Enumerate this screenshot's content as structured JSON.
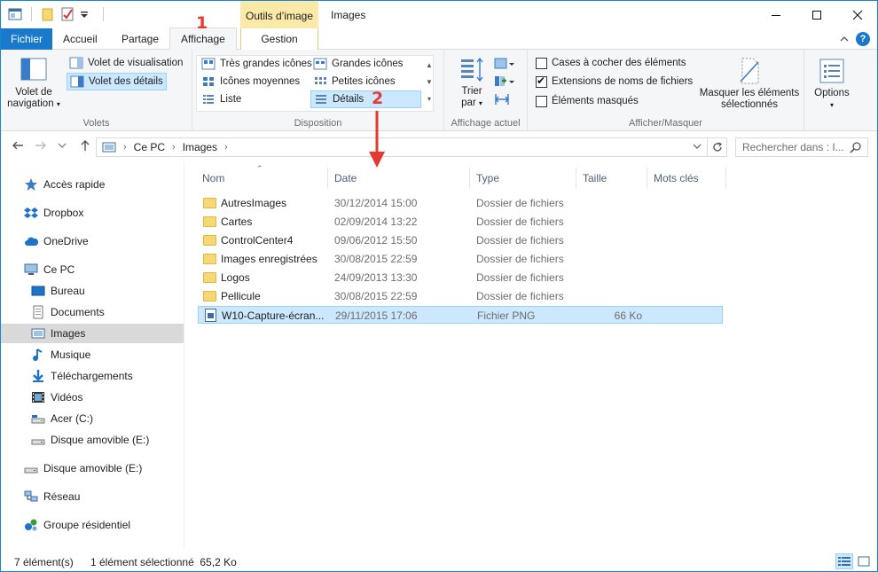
{
  "window": {
    "title": "Images",
    "contextual_tab": "Outils d’image",
    "controls": [
      "minimize-icon",
      "maximize-icon",
      "close-icon"
    ]
  },
  "tabs": {
    "file": "Fichier",
    "home": "Accueil",
    "share": "Partage",
    "view": "Affichage",
    "manage": "Gestion"
  },
  "ribbon": {
    "panes": {
      "label": "Volets",
      "nav_pane": "Volet de navigation",
      "preview_pane": "Volet de visualisation",
      "details_pane": "Volet des détails"
    },
    "layout": {
      "label": "Disposition",
      "options": [
        "Très grandes icônes",
        "Grandes icônes",
        "Icônes moyennes",
        "Petites icônes",
        "Liste",
        "Détails"
      ],
      "selected": "Détails"
    },
    "current_view": {
      "label": "Affichage actuel",
      "sort_by": "Trier par"
    },
    "show_hide": {
      "label": "Afficher/Masquer",
      "item_checkboxes": "Cases à cocher des éléments",
      "file_extensions": "Extensions de noms de fichiers",
      "hidden_items": "Éléments masqués",
      "hide_selected": "Masquer les éléments sélectionnés"
    },
    "options": "Options"
  },
  "address": {
    "crumbs": [
      "Ce PC",
      "Images"
    ],
    "search_placeholder": "Rechercher dans : I..."
  },
  "sidebar": {
    "items": [
      {
        "label": "Accès rapide",
        "icon": "star-icon"
      },
      {
        "label": "Dropbox",
        "icon": "dropbox-icon"
      },
      {
        "label": "OneDrive",
        "icon": "cloud-icon"
      },
      {
        "label": "Ce PC",
        "icon": "computer-icon"
      },
      {
        "label": "Bureau",
        "icon": "desktop-icon"
      },
      {
        "label": "Documents",
        "icon": "document-icon"
      },
      {
        "label": "Images",
        "icon": "pictures-icon"
      },
      {
        "label": "Musique",
        "icon": "music-icon"
      },
      {
        "label": "Téléchargements",
        "icon": "download-icon"
      },
      {
        "label": "Vidéos",
        "icon": "video-icon"
      },
      {
        "label": "Acer (C:)",
        "icon": "drive-icon"
      },
      {
        "label": "Disque amovible (E:)",
        "icon": "removable-drive-icon"
      },
      {
        "label": "Disque amovible (E:)",
        "icon": "removable-drive-icon"
      },
      {
        "label": "Réseau",
        "icon": "network-icon"
      },
      {
        "label": "Groupe résidentiel",
        "icon": "homegroup-icon"
      }
    ],
    "selected": "Images"
  },
  "list": {
    "columns": [
      "Nom",
      "Date",
      "Type",
      "Taille",
      "Mots clés"
    ],
    "rows": [
      {
        "name": "AutresImages",
        "date": "30/12/2014 15:00",
        "type": "Dossier de fichiers",
        "size": ""
      },
      {
        "name": "Cartes",
        "date": "02/09/2014 13:22",
        "type": "Dossier de fichiers",
        "size": ""
      },
      {
        "name": "ControlCenter4",
        "date": "09/06/2012 15:50",
        "type": "Dossier de fichiers",
        "size": ""
      },
      {
        "name": "Images enregistrées",
        "date": "30/08/2015 22:59",
        "type": "Dossier de fichiers",
        "size": ""
      },
      {
        "name": "Logos",
        "date": "24/09/2013 13:30",
        "type": "Dossier de fichiers",
        "size": ""
      },
      {
        "name": "Pellicule",
        "date": "30/08/2015 22:59",
        "type": "Dossier de fichiers",
        "size": ""
      },
      {
        "name": "W10-Capture-écran...",
        "date": "29/11/2015 17:06",
        "type": "Fichier PNG",
        "size": "66 Ko"
      }
    ],
    "selected_index": 6
  },
  "status": {
    "count": "7 élément(s)",
    "selection": "1 élément sélectionné  65,2 Ko"
  },
  "annotations": {
    "step1": "1",
    "step2": "2",
    "color": "#e53a2f"
  },
  "colors": {
    "accent": "#1979ca",
    "selection": "#cce8ff",
    "selection_border": "#99d1ff",
    "contextual": "#fbe9a8"
  }
}
